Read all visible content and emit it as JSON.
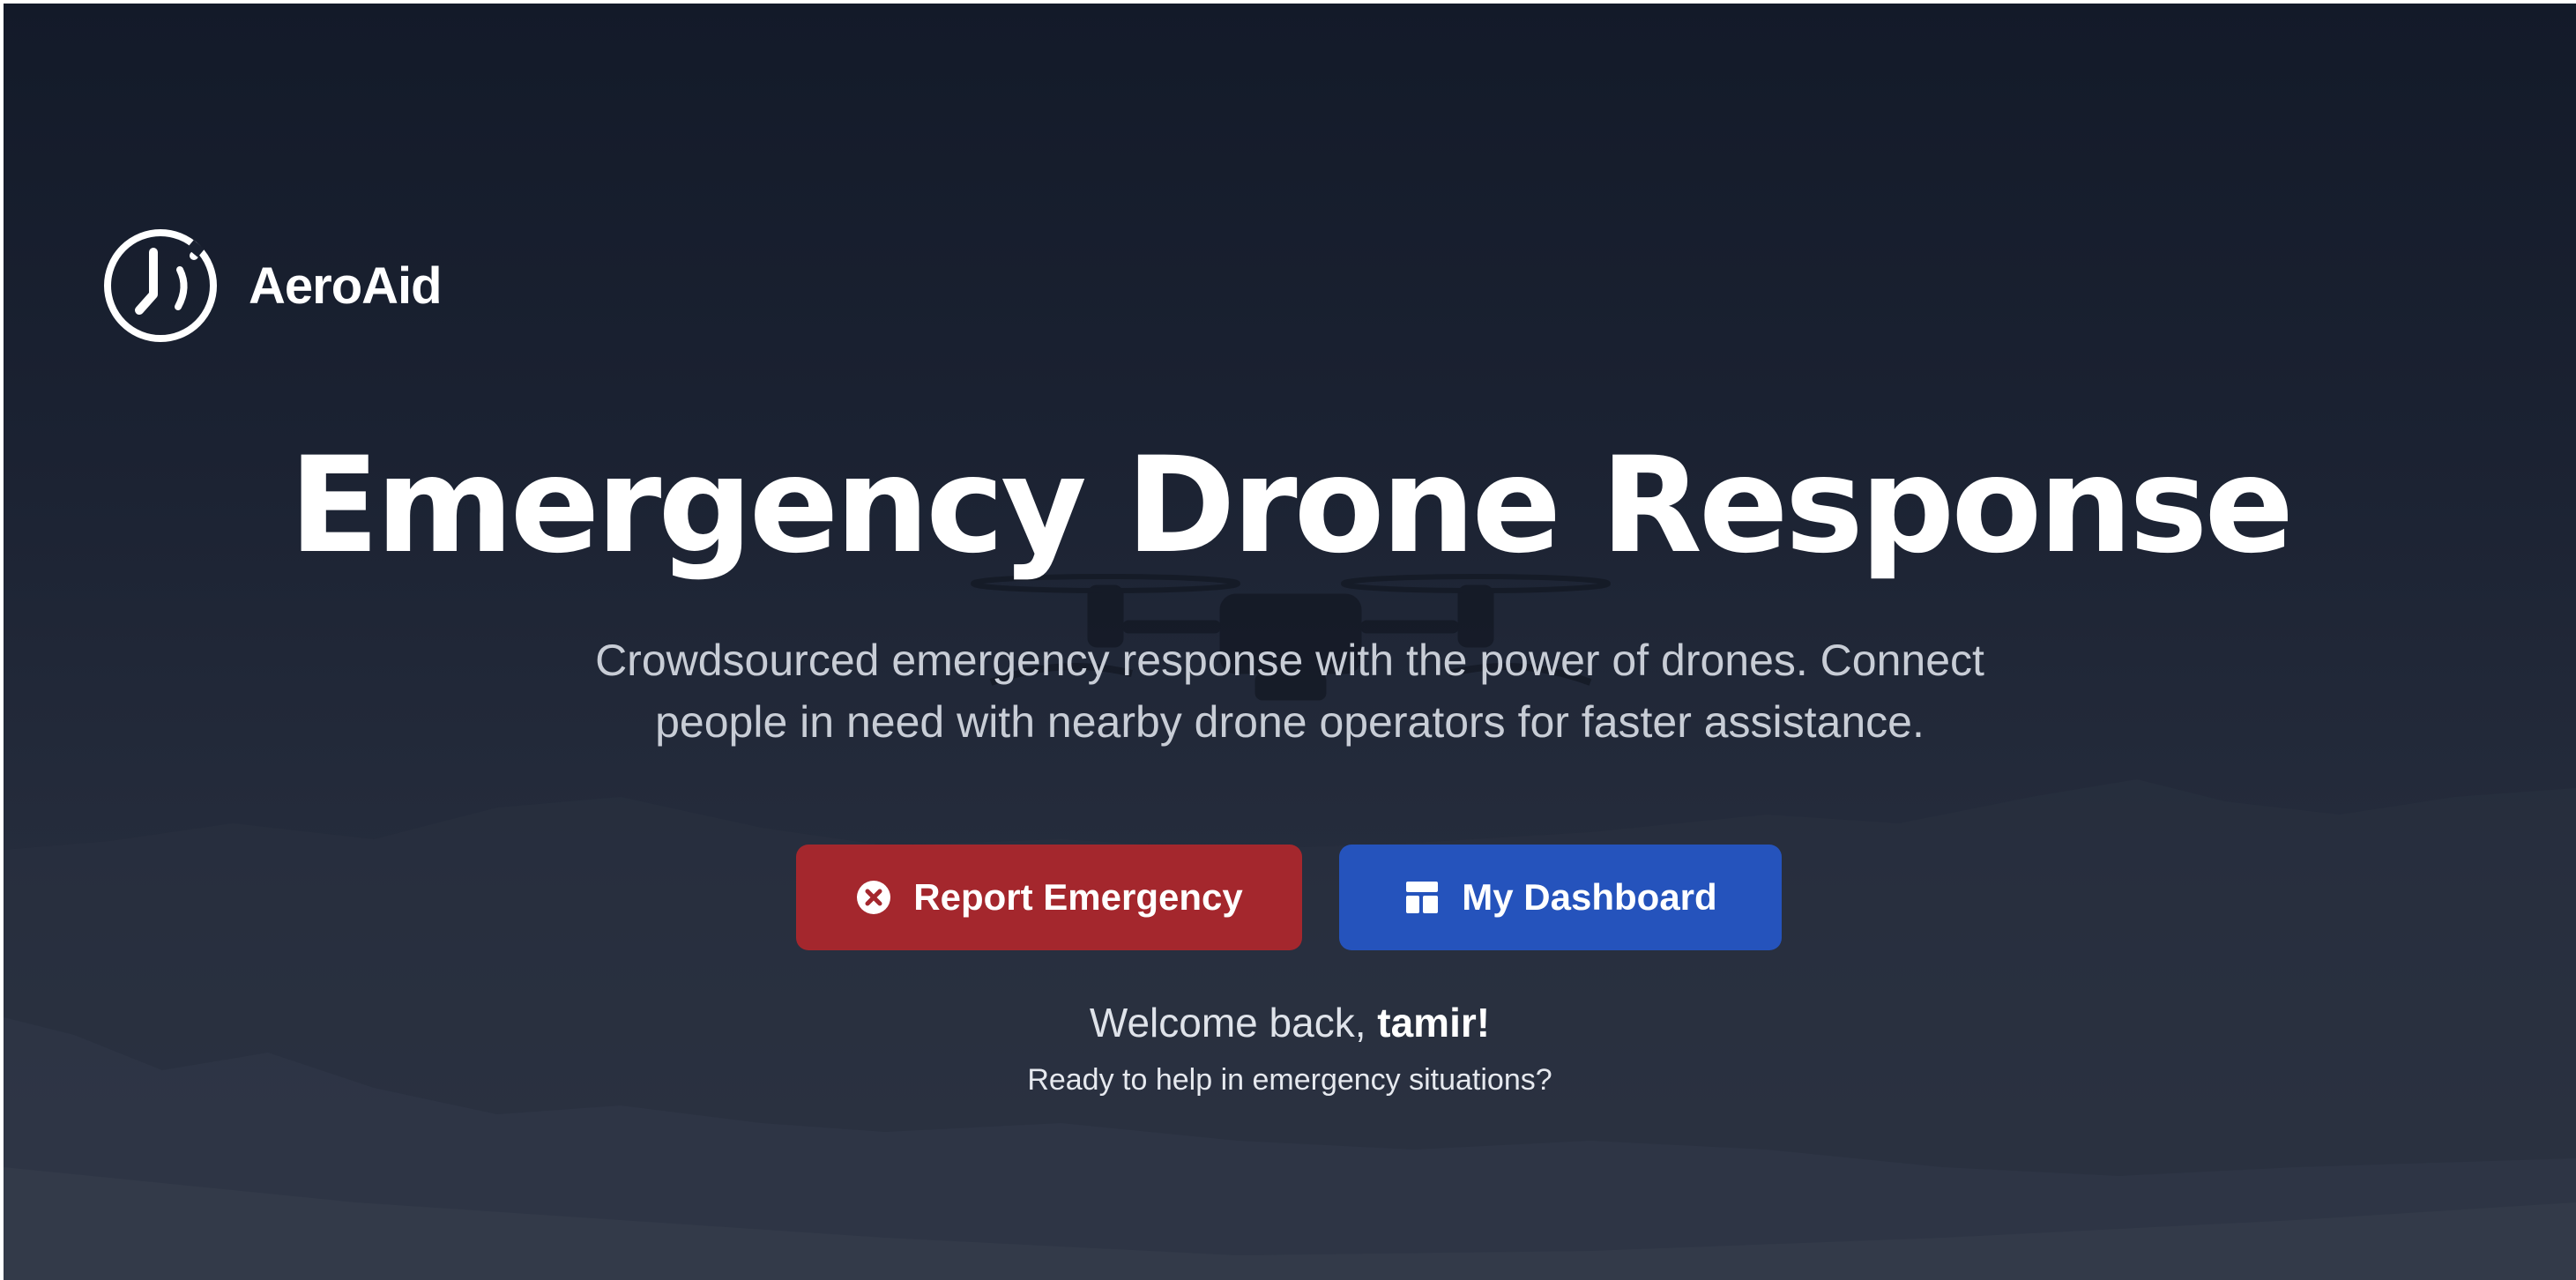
{
  "brand": {
    "name": "AeroAid",
    "logo_icon": "drone-clock-icon"
  },
  "hero": {
    "title": "Emergency Drone Response",
    "subtitle": "Crowdsourced emergency response with the power of drones. Connect people in need with nearby drone operators for faster assistance."
  },
  "actions": {
    "report_emergency": {
      "label": "Report Emergency",
      "icon": "close-circle-icon",
      "color": "#a4272d"
    },
    "dashboard": {
      "label": "My Dashboard",
      "icon": "dashboard-layout-icon",
      "color": "#2553bc"
    }
  },
  "welcome": {
    "prefix": "Welcome back,",
    "username": "tamir!",
    "tagline": "Ready to help in emergency situations?"
  },
  "colors": {
    "background_top": "#131a29",
    "background_bottom": "#2d3443"
  }
}
